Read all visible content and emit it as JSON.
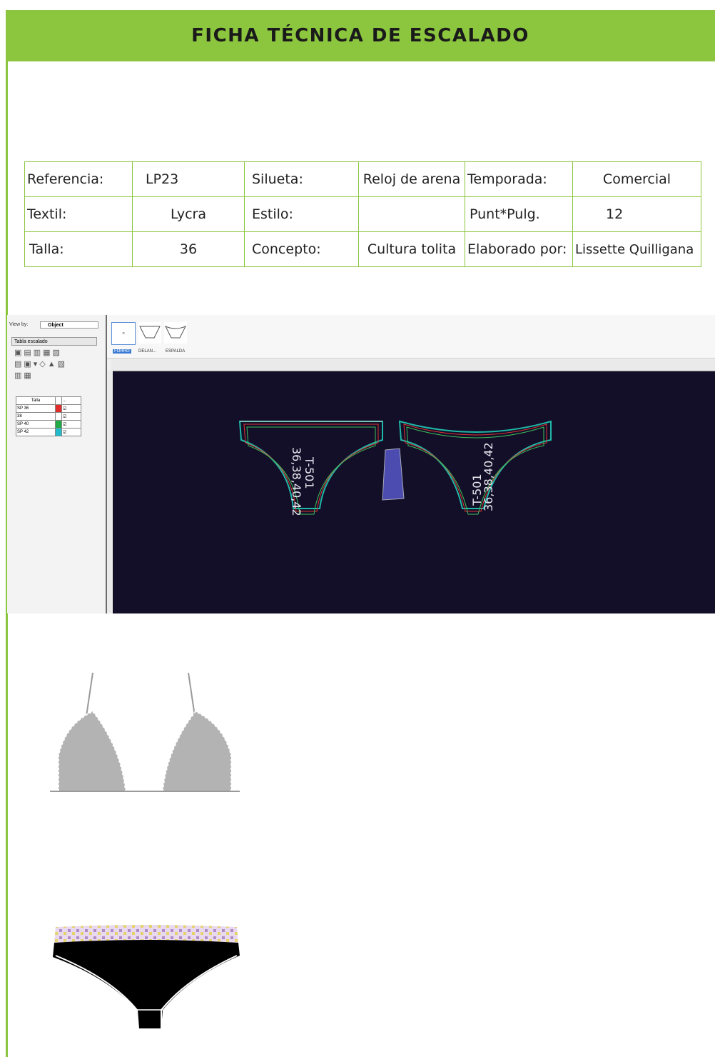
{
  "header": {
    "title": "FICHA TÉCNICA DE ESCALADO"
  },
  "info_table": {
    "rows": [
      [
        "Referencia:",
        "LP23",
        "Silueta:",
        "Reloj de arena",
        "Temporada:",
        "Comercial"
      ],
      [
        "Textil:",
        "Lycra",
        "Estilo:",
        "",
        "Punt*Pulg.",
        "12"
      ],
      [
        "Talla:",
        "36",
        "Concepto:",
        "Cultura tolita",
        "Elaborado por:",
        "Lissette Quilligana"
      ]
    ]
  },
  "software": {
    "view_by_label": "View by:",
    "view_by_value": "Object",
    "panel_title": "Tabla escalado",
    "size_header": [
      "Talla",
      "",
      "..."
    ],
    "sizes": [
      "SP 36",
      "38",
      "SP 40",
      "SP 42"
    ],
    "size_colors": [
      "#e22b2b",
      "#ffffff",
      "#22aa44",
      "#22bbcc"
    ],
    "thumb_labels": [
      "FORRO",
      "DELAN...",
      "ESPALDA"
    ],
    "piece_labels": {
      "front_code": "T-501",
      "front_sizes": "36,38,40,42",
      "back_code": "T-501",
      "back_sizes": "36,38,40,42"
    }
  },
  "colors": {
    "accent": "#8cc63f",
    "canvas": "#130f28",
    "bikini_top": "#b3b3b3",
    "bikini_bottom": "#000000"
  }
}
